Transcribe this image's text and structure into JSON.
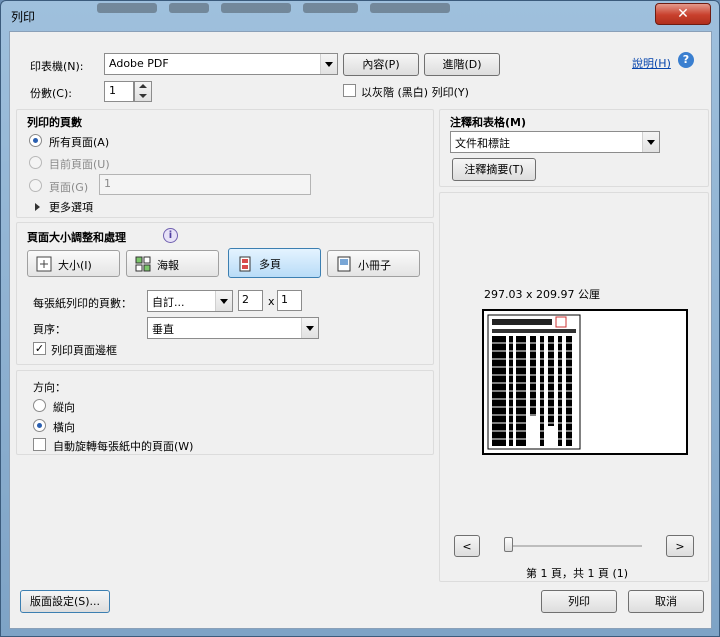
{
  "window": {
    "title": "列印",
    "close_symbol": "✕"
  },
  "printer": {
    "printer_label": "印表機(N):",
    "printer_value": "Adobe PDF",
    "properties_button": "內容(P)",
    "advanced_button": "進階(D)",
    "help_link": "說明(H)",
    "copies_label": "份數(C):",
    "copies_value": "1",
    "grayscale_label": "以灰階 (黑白) 列印(Y)"
  },
  "pages": {
    "heading": "列印的頁數",
    "all_pages": "所有頁面(A)",
    "current_page": "目前頁面(U)",
    "pages": "頁面(G)",
    "pages_value": "1",
    "more_options": "更多選項"
  },
  "sizing": {
    "heading": "頁面大小調整和處理",
    "info_symbol": "i",
    "mode_size": "大小(I)",
    "mode_poster": "海報",
    "mode_multiple": "多頁",
    "mode_booklet": "小冊子",
    "pages_per_sheet_label": "每張紙列印的頁數：",
    "pages_per_sheet_value": "自訂...",
    "cols_value": "2",
    "times_symbol": "x",
    "rows_value": "1",
    "page_order_label": "頁序：",
    "page_order_value": "垂直",
    "print_border_label": "列印頁面邊框"
  },
  "orientation": {
    "heading": "方向：",
    "portrait": "縱向",
    "landscape": "橫向",
    "auto_rotate": "自動旋轉每張紙中的頁面(W)"
  },
  "comments": {
    "heading": "注釋和表格(M)",
    "value": "文件和標註",
    "summarize_button": "注釋摘要(T)"
  },
  "preview": {
    "dimensions": "297.03 x 209.97 公厘",
    "prev_symbol": "<",
    "next_symbol": ">",
    "page_status": "第 1 頁，共 1 頁 (1)",
    "slider_position": 0
  },
  "footer": {
    "page_setup_button": "版面設定(S)...",
    "print_button": "列印",
    "cancel_button": "取消"
  },
  "colors": {
    "accent": "#3c7fb1",
    "close": "#c8402d",
    "link": "#0645ad"
  }
}
